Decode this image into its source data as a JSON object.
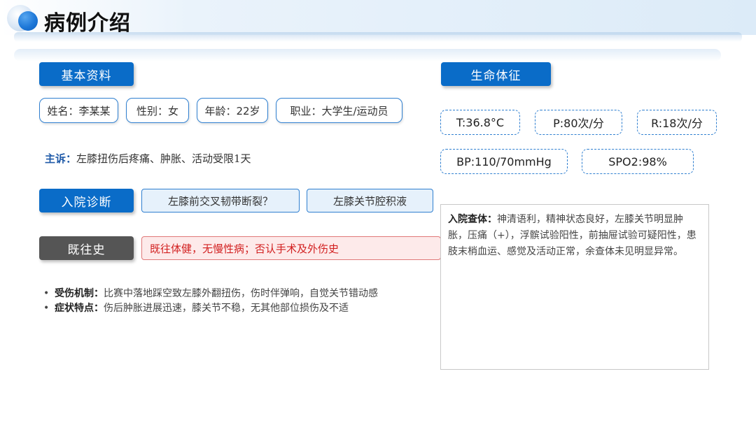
{
  "header": {
    "title": "病例介绍"
  },
  "basic_info": {
    "tag": "基本资料",
    "name": "姓名：李某某",
    "gender": "性别：女",
    "age": "年龄：22岁",
    "occupation": "职业：大学生/运动员"
  },
  "complaint": {
    "label": "主诉：",
    "text": "左膝扭伤后疼痛、肿胀、活动受限1天"
  },
  "admission_diagnosis": {
    "tag": "入院诊断",
    "items": [
      "左膝前交叉韧带断裂？",
      "左膝关节腔积液"
    ]
  },
  "past_history": {
    "tag": "既往史",
    "text": "既往体健，无慢性病；否认手术及外伤史"
  },
  "bullets": [
    {
      "bullet": "•",
      "label": "受伤机制：",
      "text": "比赛中落地踩空致左膝外翻扭伤，伤时伴弹响，自觉关节错动感"
    },
    {
      "bullet": "•",
      "label": "症状特点：",
      "text": "伤后肿胀进展迅速，膝关节不稳，无其他部位损伤及不适"
    }
  ],
  "vitals": {
    "tag": "生命体征",
    "t": "T:36.8°C",
    "p": "P:80次/分",
    "r": "R:18次/分",
    "bp": "BP:110/70mmHg",
    "spo2": "SPO2:98%"
  },
  "exam": {
    "label": "入院查体：",
    "text": "神清语利，精神状态良好，左膝关节明显肿胀，压痛（+），浮髌试验阳性，前抽屉试验可疑阳性，患肢末梢血运、感觉及活动正常，余查体未见明显异常。"
  },
  "colors": {
    "accent": "#0a6cc8",
    "history_tag": "#555555",
    "history_text": "#d22020"
  }
}
